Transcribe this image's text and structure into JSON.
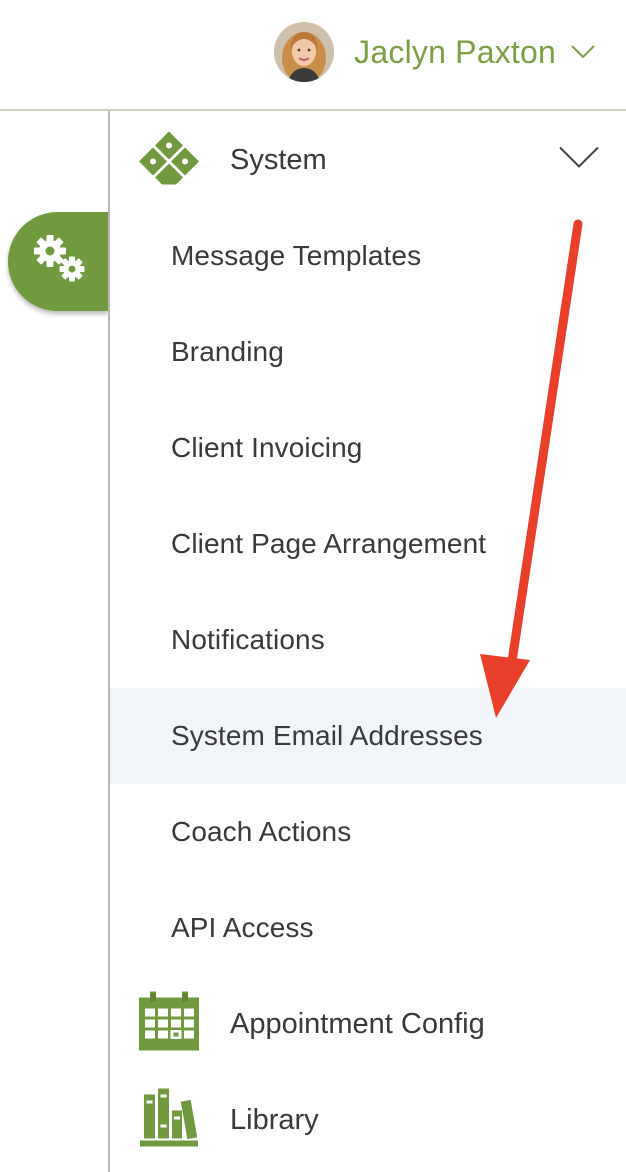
{
  "header": {
    "user_name": "Jaclyn Paxton"
  },
  "icons": {
    "settings": "gears-icon",
    "user_menu": "chevron-down-icon"
  },
  "colors": {
    "brand_green": "#7da045",
    "tab_green": "#719a3f",
    "active_row_bg": "#f1f5f9",
    "annotation_arrow": "#e8402a"
  },
  "sidebar": {
    "groups": [
      {
        "label": "System",
        "icon": "puzzle-icon",
        "expanded": true
      },
      {
        "label": "Appointment Config",
        "icon": "calendar-icon"
      },
      {
        "label": "Library",
        "icon": "books-icon"
      }
    ],
    "system_items": [
      {
        "label": "Message Templates"
      },
      {
        "label": "Branding"
      },
      {
        "label": "Client Invoicing"
      },
      {
        "label": "Client Page Arrangement"
      },
      {
        "label": "Notifications"
      },
      {
        "label": "System Email Addresses",
        "active": true
      },
      {
        "label": "Coach Actions"
      },
      {
        "label": "API Access"
      }
    ]
  }
}
